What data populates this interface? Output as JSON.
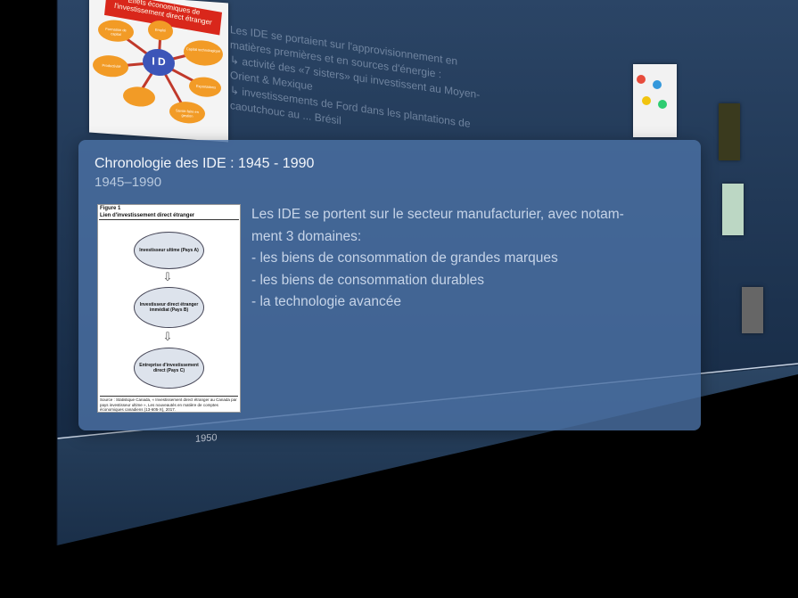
{
  "background": {
    "diagram_thumb": {
      "title": "Effets économiques de l'investissement direct étranger",
      "center": "I D",
      "bubbles": [
        "Formation de capital",
        "Emploi",
        "Productivité",
        "Capital technologique",
        "Exportations",
        "Savoir-faire en gestion"
      ]
    },
    "text_lines": [
      "Les IDE se portaient sur l'approvisionnement en",
      "matières premières et en sources d'énergie :",
      "↳ activité des «7 sisters» qui investissent au Moyen-",
      "Orient & Mexique",
      "↳ investissements de Ford dans les plantations de",
      "caoutchouc au ... Brésil"
    ],
    "timeline_year": "1950"
  },
  "card": {
    "title": "Chronologie des IDE : 1945 - 1990",
    "subtitle": "1945–1990",
    "figure": {
      "label": "Figure 1",
      "caption": "Lien d'investissement direct étranger",
      "nodes": [
        "Investisseur ultime (Pays A)",
        "Investisseur direct étranger immédiat (Pays B)",
        "Entreprise d'investissement direct (Pays C)"
      ],
      "source": "Source : Statistique Canada, « Investissement direct étranger au Canada par pays investisseur ultime », Les nouveautés en matière de comptes économiques canadiens (13-605-X), 2017."
    },
    "body_lines": [
      "Les IDE se portent sur le secteur manufacturier, avec notam-",
      "ment 3 domaines:",
      "-  les biens de consommation de grandes marques",
      "-  les biens de consommation durables",
      "-  la technologie avancée"
    ]
  },
  "colors": {
    "card_bg": "#4a70a4",
    "wall": "#1f3553",
    "card_text": "#c6d4e8"
  }
}
